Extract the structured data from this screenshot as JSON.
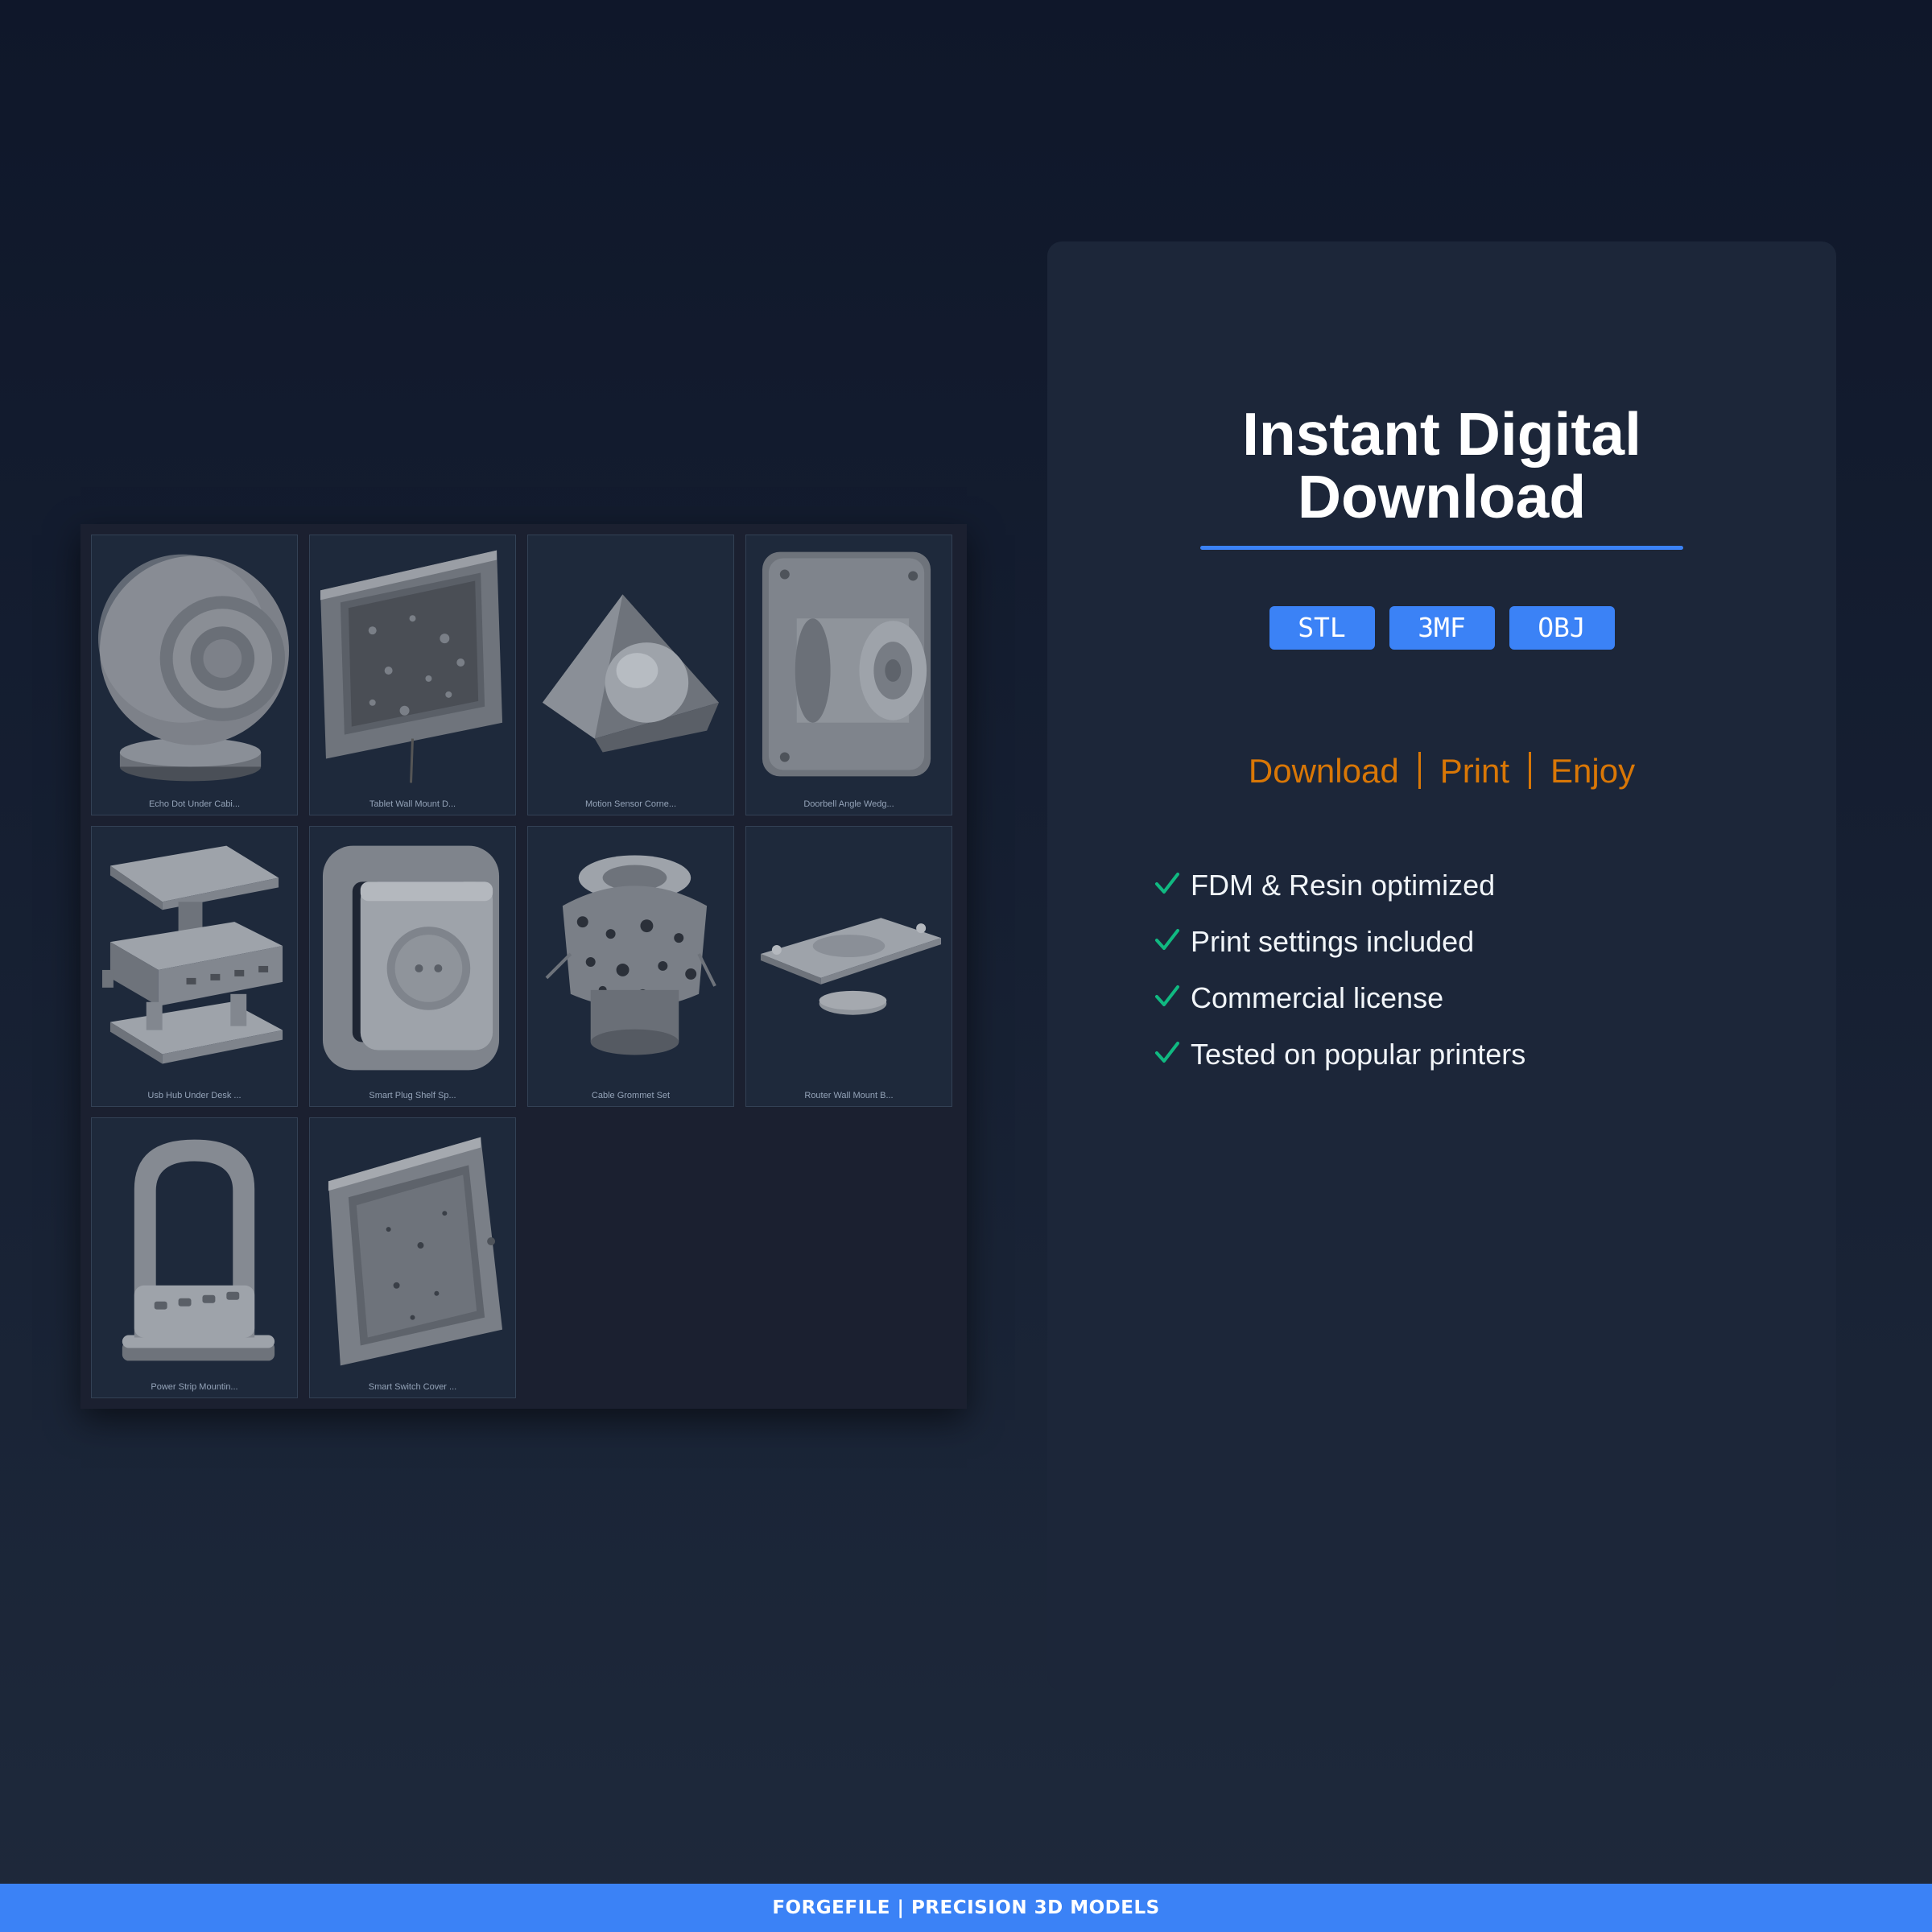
{
  "gallery": {
    "tiles": [
      {
        "caption": "Echo Dot Under Cabi...",
        "icon": "speaker-model-icon"
      },
      {
        "caption": "Tablet Wall Mount D...",
        "icon": "tablet-mount-model-icon"
      },
      {
        "caption": "Motion Sensor Corne...",
        "icon": "motion-sensor-model-icon"
      },
      {
        "caption": "Doorbell Angle Wedg...",
        "icon": "doorbell-model-icon"
      },
      {
        "caption": "Usb Hub Under Desk ...",
        "icon": "usb-hub-model-icon"
      },
      {
        "caption": "Smart Plug Shelf Sp...",
        "icon": "smart-plug-model-icon"
      },
      {
        "caption": "Cable Grommet Set",
        "icon": "cable-grommet-model-icon"
      },
      {
        "caption": "Router Wall Mount B...",
        "icon": "router-mount-model-icon"
      },
      {
        "caption": "Power Strip Mountin...",
        "icon": "power-strip-model-icon"
      },
      {
        "caption": "Smart Switch Cover ...",
        "icon": "switch-cover-model-icon"
      }
    ]
  },
  "info": {
    "title_line1": "Instant Digital",
    "title_line2": "Download",
    "formats": [
      "STL",
      "3MF",
      "OBJ"
    ],
    "tagline": [
      "Download",
      "Print",
      "Enjoy"
    ],
    "features": [
      "FDM & Resin optimized",
      "Print settings included",
      "Commercial license",
      "Tested on popular printers"
    ]
  },
  "footer": {
    "brand": "FORGEFILE",
    "separator": "|",
    "slogan": "PRECISION 3D MODELS"
  },
  "colors": {
    "accent": "#3b82f6",
    "tagline": "#d97706",
    "check": "#10b981",
    "background": "#0f172a",
    "card": "#1c2639"
  }
}
